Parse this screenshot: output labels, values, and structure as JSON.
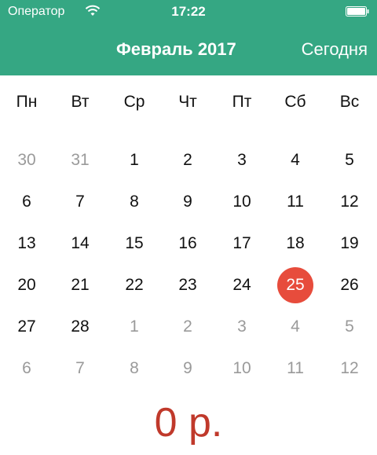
{
  "status_bar": {
    "carrier": "Оператор",
    "time": "17:22"
  },
  "header": {
    "title": "Февраль 2017",
    "today_label": "Сегодня",
    "accent": "#35a783"
  },
  "weekdays": [
    "Пн",
    "Вт",
    "Ср",
    "Чт",
    "Пт",
    "Сб",
    "Вс"
  ],
  "days": [
    {
      "label": "30",
      "month": "prev"
    },
    {
      "label": "31",
      "month": "prev"
    },
    {
      "label": "1",
      "month": "current"
    },
    {
      "label": "2",
      "month": "current"
    },
    {
      "label": "3",
      "month": "current"
    },
    {
      "label": "4",
      "month": "current"
    },
    {
      "label": "5",
      "month": "current"
    },
    {
      "label": "6",
      "month": "current"
    },
    {
      "label": "7",
      "month": "current"
    },
    {
      "label": "8",
      "month": "current"
    },
    {
      "label": "9",
      "month": "current"
    },
    {
      "label": "10",
      "month": "current"
    },
    {
      "label": "11",
      "month": "current"
    },
    {
      "label": "12",
      "month": "current"
    },
    {
      "label": "13",
      "month": "current"
    },
    {
      "label": "14",
      "month": "current"
    },
    {
      "label": "15",
      "month": "current"
    },
    {
      "label": "16",
      "month": "current"
    },
    {
      "label": "17",
      "month": "current"
    },
    {
      "label": "18",
      "month": "current"
    },
    {
      "label": "19",
      "month": "current"
    },
    {
      "label": "20",
      "month": "current"
    },
    {
      "label": "21",
      "month": "current"
    },
    {
      "label": "22",
      "month": "current"
    },
    {
      "label": "23",
      "month": "current"
    },
    {
      "label": "24",
      "month": "current"
    },
    {
      "label": "25",
      "month": "current",
      "selected": true
    },
    {
      "label": "26",
      "month": "current"
    },
    {
      "label": "27",
      "month": "current"
    },
    {
      "label": "28",
      "month": "current"
    },
    {
      "label": "1",
      "month": "next"
    },
    {
      "label": "2",
      "month": "next"
    },
    {
      "label": "3",
      "month": "next"
    },
    {
      "label": "4",
      "month": "next"
    },
    {
      "label": "5",
      "month": "next"
    },
    {
      "label": "6",
      "month": "next"
    },
    {
      "label": "7",
      "month": "next"
    },
    {
      "label": "8",
      "month": "next"
    },
    {
      "label": "9",
      "month": "next"
    },
    {
      "label": "10",
      "month": "next"
    },
    {
      "label": "11",
      "month": "next"
    },
    {
      "label": "12",
      "month": "next"
    }
  ],
  "selected_color": "#e74c3c",
  "total": "0 р.",
  "total_color": "#c0392b"
}
